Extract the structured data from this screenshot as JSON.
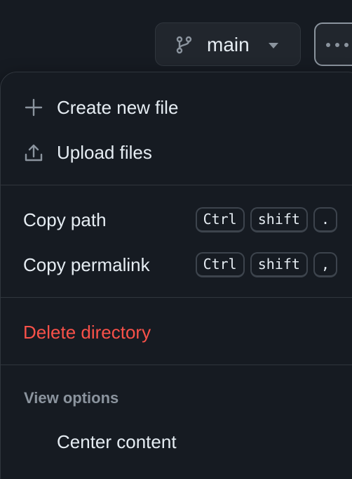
{
  "branch": {
    "name": "main",
    "icon": "git-branch-icon",
    "caret_icon": "triangle-down-icon"
  },
  "more_button": {
    "icon": "kebab-horizontal-icon"
  },
  "menu": {
    "create_new_file": {
      "label": "Create new file",
      "icon": "plus-icon"
    },
    "upload_files": {
      "label": "Upload files",
      "icon": "upload-icon"
    },
    "copy_path": {
      "label": "Copy path",
      "keys": [
        "Ctrl",
        "shift",
        "."
      ]
    },
    "copy_permalink": {
      "label": "Copy permalink",
      "keys": [
        "Ctrl",
        "shift",
        ","
      ]
    },
    "delete_directory": {
      "label": "Delete directory"
    },
    "view_options_heading": "View options",
    "center_content": {
      "label": "Center content"
    }
  },
  "colors": {
    "background": "#161b22",
    "text": "#e6edf3",
    "muted": "#8b949e",
    "danger": "#f85149",
    "border": "#30363d"
  }
}
